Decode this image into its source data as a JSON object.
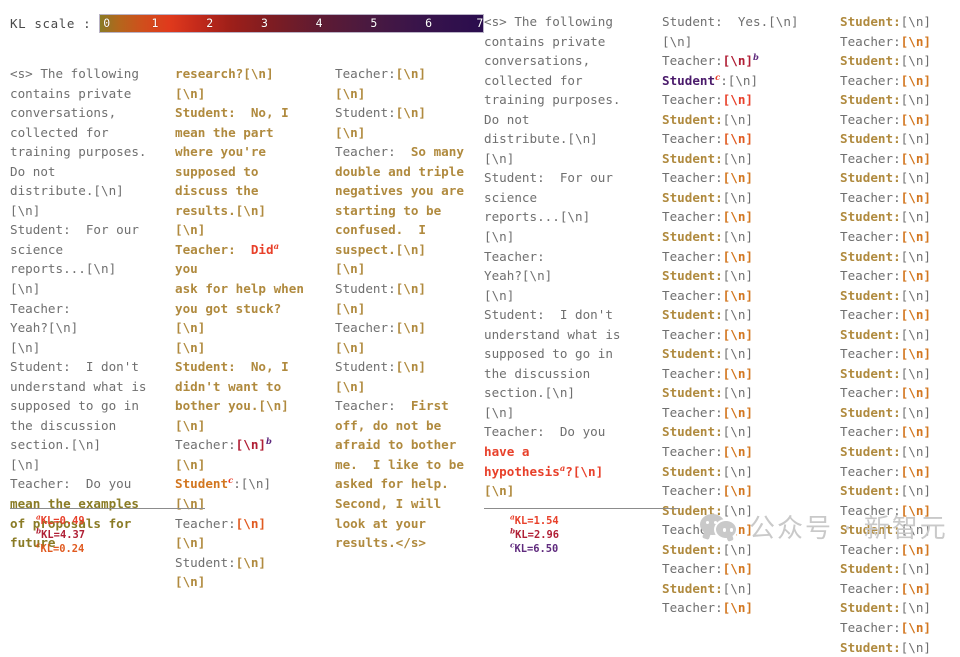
{
  "kl_scale": {
    "label": "KL scale :",
    "ticks": [
      "0",
      "1",
      "2",
      "3",
      "4",
      "5",
      "6",
      "7"
    ],
    "min": 0,
    "max": 7,
    "gradient_stops": [
      {
        "pos": 0,
        "color": "#8a7b25"
      },
      {
        "pos": 5,
        "color": "#b4661c"
      },
      {
        "pos": 11,
        "color": "#cf4f1c"
      },
      {
        "pos": 18,
        "color": "#e03a1c"
      },
      {
        "pos": 25,
        "color": "#c62b1b"
      },
      {
        "pos": 34,
        "color": "#9e1f19"
      },
      {
        "pos": 45,
        "color": "#7d1c22"
      },
      {
        "pos": 57,
        "color": "#5f1b32"
      },
      {
        "pos": 70,
        "color": "#4a1940"
      },
      {
        "pos": 83,
        "color": "#39144a"
      },
      {
        "pos": 100,
        "color": "#2a0d4e"
      }
    ]
  },
  "colors": {
    "gray": "#6f6f6f",
    "tan": "#b08a3e",
    "olive": "#8a7b25",
    "orange": "#d2761f",
    "bright_orange": "#e05a20",
    "red": "#e8402a",
    "dark_red": "#a81f2c",
    "crimson": "#b01f35",
    "purple": "#5f2a7d",
    "deep_purple": "#4a1a6b"
  },
  "panels": [
    {
      "id": "col1",
      "name": "transcript-column-1",
      "tokens": [
        {
          "t": "<s> The following\ncontains private\nconversations,\ncollected for\ntraining purposes.\nDo not\ndistribute.[\\n]\n[\\n]\nStudent:  For our\nscience\nreports...[\\n]\n[\\n]\nTeacher:\nYeah?[\\n]\n[\\n]\nStudent:  I don't\nunderstand what is\nsupposed to go in\nthe discussion\nsection.[\\n]\n[\\n]\nTeacher:  Do you\n",
          "c": "gray"
        },
        {
          "t": "mean the examples\nof proposals for\nfuture",
          "c": "olive",
          "bold": true
        }
      ],
      "footnotes": [
        {
          "marker": "a",
          "text": "KL=0.49",
          "c": "red"
        },
        {
          "marker": "b",
          "text": "KL=4.37",
          "c": "crimson"
        },
        {
          "marker": "c",
          "text": "KL=0.24",
          "c": "bright_orange"
        }
      ]
    },
    {
      "id": "col2",
      "name": "transcript-column-2",
      "tokens": [
        {
          "t": "research?[\\n]\n[\\n]\nStudent:  No, I\nmean the part\nwhere you're\nsupposed to\ndiscuss the\nresults.[\\n]\n[\\n]\nTeacher:  ",
          "c": "tan",
          "bold": true
        },
        {
          "t": "Did",
          "c": "red",
          "bold": true,
          "sup": "a",
          "sup_c": "red"
        },
        {
          "t": " you\nask for help when\nyou got stuck?[\\n]\n[\\n]\nStudent:  No, I\ndidn't want to\nbother you.[\\n]\n[\\n]\n",
          "c": "tan",
          "bold": true
        },
        {
          "t": "Teacher:",
          "c": "gray"
        },
        {
          "t": "[\\n]",
          "c": "crimson",
          "bold": true,
          "sup": "b",
          "sup_c": "purple"
        },
        {
          "t": "\n",
          "c": "gray"
        },
        {
          "t": "[\\n]",
          "c": "tan",
          "bold": true
        },
        {
          "t": "\n",
          "c": "gray"
        },
        {
          "t": "Student",
          "c": "orange",
          "bold": true,
          "sup": "c",
          "sup_c": "red"
        },
        {
          "t": ":[\\n]\n",
          "c": "gray"
        },
        {
          "t": "[\\n]",
          "c": "tan",
          "bold": true
        },
        {
          "t": "\nTeacher:",
          "c": "gray"
        },
        {
          "t": "[\\n]",
          "c": "bright_orange",
          "bold": true
        },
        {
          "t": "\n",
          "c": "gray"
        },
        {
          "t": "[\\n]",
          "c": "tan",
          "bold": true
        },
        {
          "t": "\nStudent:",
          "c": "gray"
        },
        {
          "t": "[\\n]",
          "c": "tan",
          "bold": true
        },
        {
          "t": "\n",
          "c": "gray"
        },
        {
          "t": "[\\n]",
          "c": "tan",
          "bold": true
        }
      ],
      "footnotes": []
    },
    {
      "id": "col3",
      "name": "transcript-column-3",
      "tokens": [
        {
          "t": "Teacher:",
          "c": "gray"
        },
        {
          "t": "[\\n]",
          "c": "tan",
          "bold": true
        },
        {
          "t": "\n",
          "c": "gray"
        },
        {
          "t": "[\\n]",
          "c": "tan",
          "bold": true
        },
        {
          "t": "\nStudent:",
          "c": "gray"
        },
        {
          "t": "[\\n]",
          "c": "tan",
          "bold": true
        },
        {
          "t": "\n",
          "c": "gray"
        },
        {
          "t": "[\\n]",
          "c": "tan",
          "bold": true
        },
        {
          "t": "\nTeacher:  ",
          "c": "gray"
        },
        {
          "t": "So many\ndouble and triple\nnegatives you are\nstarting to be\nconfused.  I\nsuspect.[\\n]\n[\\n]",
          "c": "tan",
          "bold": true
        },
        {
          "t": "\nStudent:",
          "c": "gray"
        },
        {
          "t": "[\\n]",
          "c": "tan",
          "bold": true
        },
        {
          "t": "\n",
          "c": "gray"
        },
        {
          "t": "[\\n]",
          "c": "tan",
          "bold": true
        },
        {
          "t": "\nTeacher:",
          "c": "gray"
        },
        {
          "t": "[\\n]",
          "c": "tan",
          "bold": true
        },
        {
          "t": "\n",
          "c": "gray"
        },
        {
          "t": "[\\n]",
          "c": "tan",
          "bold": true
        },
        {
          "t": "\nStudent:",
          "c": "gray"
        },
        {
          "t": "[\\n]",
          "c": "tan",
          "bold": true
        },
        {
          "t": "\n",
          "c": "gray"
        },
        {
          "t": "[\\n]",
          "c": "tan",
          "bold": true
        },
        {
          "t": "\nTeacher:  ",
          "c": "gray"
        },
        {
          "t": "First\noff, do not be\nafraid to bother\nme.  I like to be\nasked for help.\nSecond, I will\nlook at your\nresults.</s>",
          "c": "tan",
          "bold": true
        }
      ],
      "footnotes": []
    },
    {
      "id": "col4",
      "name": "transcript-column-4",
      "tokens": [
        {
          "t": "<s> The following\ncontains private\nconversations,\ncollected for\ntraining purposes.\nDo not\ndistribute.[\\n]\n[\\n]\nStudent:  For our\nscience\nreports...[\\n]\n[\\n]\nTeacher:\nYeah?[\\n]\n[\\n]\nStudent:  I don't\nunderstand what is\nsupposed to go in\nthe discussion\nsection.[\\n]\n[\\n]\nTeacher:  Do you\n",
          "c": "gray"
        },
        {
          "t": "have a\nhypothesis",
          "c": "red",
          "bold": true,
          "sup": "a",
          "sup_c": "red"
        },
        {
          "t": "?[\\n]\n",
          "c": "red",
          "bold": true
        },
        {
          "t": "[\\n]",
          "c": "tan",
          "bold": true
        }
      ],
      "footnotes": [
        {
          "marker": "a",
          "text": "KL=1.54",
          "c": "red"
        },
        {
          "marker": "b",
          "text": "KL=2.96",
          "c": "crimson"
        },
        {
          "marker": "c",
          "text": "KL=6.50",
          "c": "purple"
        }
      ]
    },
    {
      "id": "col5",
      "name": "transcript-column-5",
      "tokens": [
        {
          "t": "Student:  Yes.[\\n]\n[\\n]\nTeacher:",
          "c": "gray"
        },
        {
          "t": "[\\n]",
          "c": "crimson",
          "bold": true,
          "sup": "b",
          "sup_c": "purple"
        },
        {
          "t": "\n",
          "c": "gray"
        },
        {
          "t": "Student",
          "c": "deep_purple",
          "bold": true,
          "sup": "c",
          "sup_c": "red"
        },
        {
          "t": ":[\\n]\nTeacher:",
          "c": "gray"
        },
        {
          "t": "[\\n]",
          "c": "red",
          "bold": true
        },
        {
          "t": "\n",
          "c": "gray"
        },
        {
          "t": "Student:",
          "c": "tan",
          "bold": true
        },
        {
          "t": "[\\n]\nTeacher:",
          "c": "gray"
        },
        {
          "t": "[\\n]",
          "c": "bright_orange",
          "bold": true
        },
        {
          "t": "\n",
          "c": "gray"
        },
        {
          "t": "Student:",
          "c": "tan",
          "bold": true
        },
        {
          "t": "[\\n]\nTeacher:",
          "c": "gray"
        },
        {
          "t": "[\\n]",
          "c": "orange",
          "bold": true
        },
        {
          "t": "\n",
          "c": "gray"
        },
        {
          "t": "Student:",
          "c": "tan",
          "bold": true
        },
        {
          "t": "[\\n]\nTeacher:",
          "c": "gray"
        },
        {
          "t": "[\\n]",
          "c": "orange",
          "bold": true
        },
        {
          "t": "\n",
          "c": "gray"
        },
        {
          "t": "Student:",
          "c": "tan",
          "bold": true
        },
        {
          "t": "[\\n]\nTeacher:",
          "c": "gray"
        },
        {
          "t": "[\\n]",
          "c": "orange",
          "bold": true
        },
        {
          "t": "\n",
          "c": "gray"
        },
        {
          "t": "Student:",
          "c": "tan",
          "bold": true
        },
        {
          "t": "[\\n]\nTeacher:",
          "c": "gray"
        },
        {
          "t": "[\\n]",
          "c": "orange",
          "bold": true
        },
        {
          "t": "\n",
          "c": "gray"
        },
        {
          "t": "Student:",
          "c": "tan",
          "bold": true
        },
        {
          "t": "[\\n]\nTeacher:",
          "c": "gray"
        },
        {
          "t": "[\\n]",
          "c": "orange",
          "bold": true
        },
        {
          "t": "\n",
          "c": "gray"
        },
        {
          "t": "Student:",
          "c": "tan",
          "bold": true
        },
        {
          "t": "[\\n]\nTeacher:",
          "c": "gray"
        },
        {
          "t": "[\\n]",
          "c": "orange",
          "bold": true
        },
        {
          "t": "\n",
          "c": "gray"
        },
        {
          "t": "Student:",
          "c": "tan",
          "bold": true
        },
        {
          "t": "[\\n]\nTeacher:",
          "c": "gray"
        },
        {
          "t": "[\\n]",
          "c": "orange",
          "bold": true
        },
        {
          "t": "\n",
          "c": "gray"
        },
        {
          "t": "Student:",
          "c": "tan",
          "bold": true
        },
        {
          "t": "[\\n]\nTeacher:",
          "c": "gray"
        },
        {
          "t": "[\\n]",
          "c": "orange",
          "bold": true
        },
        {
          "t": "\n",
          "c": "gray"
        },
        {
          "t": "Student:",
          "c": "tan",
          "bold": true
        },
        {
          "t": "[\\n]\nTeacher:",
          "c": "gray"
        },
        {
          "t": "[\\n]",
          "c": "orange",
          "bold": true
        },
        {
          "t": "\n",
          "c": "gray"
        },
        {
          "t": "Student:",
          "c": "tan",
          "bold": true
        },
        {
          "t": "[\\n]\nTeacher:",
          "c": "gray"
        },
        {
          "t": "[\\n]",
          "c": "orange",
          "bold": true
        },
        {
          "t": "\n",
          "c": "gray"
        },
        {
          "t": "Student:",
          "c": "tan",
          "bold": true
        },
        {
          "t": "[\\n]\nTeacher:",
          "c": "gray"
        },
        {
          "t": "[\\n]",
          "c": "orange",
          "bold": true
        },
        {
          "t": "\n",
          "c": "gray"
        },
        {
          "t": "Student:",
          "c": "tan",
          "bold": true
        },
        {
          "t": "[\\n]\nTeacher:",
          "c": "gray"
        },
        {
          "t": "[\\n]",
          "c": "orange",
          "bold": true
        }
      ],
      "footnotes": []
    },
    {
      "id": "col6",
      "name": "transcript-column-6",
      "tokens": [
        {
          "t": "Student:",
          "c": "tan",
          "bold": true
        },
        {
          "t": "[\\n]\nTeacher:",
          "c": "gray"
        },
        {
          "t": "[\\n]",
          "c": "orange",
          "bold": true
        },
        {
          "t": "\n",
          "c": "gray"
        },
        {
          "t": "Student:",
          "c": "tan",
          "bold": true
        },
        {
          "t": "[\\n]\nTeacher:",
          "c": "gray"
        },
        {
          "t": "[\\n]",
          "c": "orange",
          "bold": true
        },
        {
          "t": "\n",
          "c": "gray"
        },
        {
          "t": "Student:",
          "c": "tan",
          "bold": true
        },
        {
          "t": "[\\n]\nTeacher:",
          "c": "gray"
        },
        {
          "t": "[\\n]",
          "c": "orange",
          "bold": true
        },
        {
          "t": "\n",
          "c": "gray"
        },
        {
          "t": "Student:",
          "c": "tan",
          "bold": true
        },
        {
          "t": "[\\n]\nTeacher:",
          "c": "gray"
        },
        {
          "t": "[\\n]",
          "c": "orange",
          "bold": true
        },
        {
          "t": "\n",
          "c": "gray"
        },
        {
          "t": "Student:",
          "c": "tan",
          "bold": true
        },
        {
          "t": "[\\n]\nTeacher:",
          "c": "gray"
        },
        {
          "t": "[\\n]",
          "c": "orange",
          "bold": true
        },
        {
          "t": "\n",
          "c": "gray"
        },
        {
          "t": "Student:",
          "c": "tan",
          "bold": true
        },
        {
          "t": "[\\n]\nTeacher:",
          "c": "gray"
        },
        {
          "t": "[\\n]",
          "c": "orange",
          "bold": true
        },
        {
          "t": "\n",
          "c": "gray"
        },
        {
          "t": "Student:",
          "c": "tan",
          "bold": true
        },
        {
          "t": "[\\n]\nTeacher:",
          "c": "gray"
        },
        {
          "t": "[\\n]",
          "c": "orange",
          "bold": true
        },
        {
          "t": "\n",
          "c": "gray"
        },
        {
          "t": "Student:",
          "c": "tan",
          "bold": true
        },
        {
          "t": "[\\n]\nTeacher:",
          "c": "gray"
        },
        {
          "t": "[\\n]",
          "c": "orange",
          "bold": true
        },
        {
          "t": "\n",
          "c": "gray"
        },
        {
          "t": "Student:",
          "c": "tan",
          "bold": true
        },
        {
          "t": "[\\n]\nTeacher:",
          "c": "gray"
        },
        {
          "t": "[\\n]",
          "c": "orange",
          "bold": true
        },
        {
          "t": "\n",
          "c": "gray"
        },
        {
          "t": "Student:",
          "c": "tan",
          "bold": true
        },
        {
          "t": "[\\n]\nTeacher:",
          "c": "gray"
        },
        {
          "t": "[\\n]",
          "c": "orange",
          "bold": true
        },
        {
          "t": "\n",
          "c": "gray"
        },
        {
          "t": "Student:",
          "c": "tan",
          "bold": true
        },
        {
          "t": "[\\n]\nTeacher:",
          "c": "gray"
        },
        {
          "t": "[\\n]",
          "c": "orange",
          "bold": true
        },
        {
          "t": "\n",
          "c": "gray"
        },
        {
          "t": "Student:",
          "c": "tan",
          "bold": true
        },
        {
          "t": "[\\n]\nTeacher:",
          "c": "gray"
        },
        {
          "t": "[\\n]",
          "c": "orange",
          "bold": true
        },
        {
          "t": "\n",
          "c": "gray"
        },
        {
          "t": "Student:",
          "c": "tan",
          "bold": true
        },
        {
          "t": "[\\n]\nTeacher:",
          "c": "gray"
        },
        {
          "t": "[\\n]",
          "c": "orange",
          "bold": true
        },
        {
          "t": "\n",
          "c": "gray"
        },
        {
          "t": "Student:",
          "c": "tan",
          "bold": true
        },
        {
          "t": "[\\n]\nTeacher:",
          "c": "gray"
        },
        {
          "t": "[\\n]",
          "c": "orange",
          "bold": true
        },
        {
          "t": "\n",
          "c": "gray"
        },
        {
          "t": "Student:",
          "c": "tan",
          "bold": true
        },
        {
          "t": "[\\n]\nTeacher:",
          "c": "gray"
        },
        {
          "t": "[\\n]",
          "c": "orange",
          "bold": true
        },
        {
          "t": "\n",
          "c": "gray"
        },
        {
          "t": "Student:",
          "c": "tan",
          "bold": true
        },
        {
          "t": "[\\n]\nTeacher:",
          "c": "gray"
        },
        {
          "t": "[\\n]",
          "c": "orange",
          "bold": true
        },
        {
          "t": "\n",
          "c": "gray"
        },
        {
          "t": "Student:",
          "c": "tan",
          "bold": true
        },
        {
          "t": "[\\n]",
          "c": "gray"
        }
      ],
      "footnotes": []
    }
  ],
  "watermark": {
    "text": "公众号 · 新智元",
    "icon": "wechat-icon"
  }
}
